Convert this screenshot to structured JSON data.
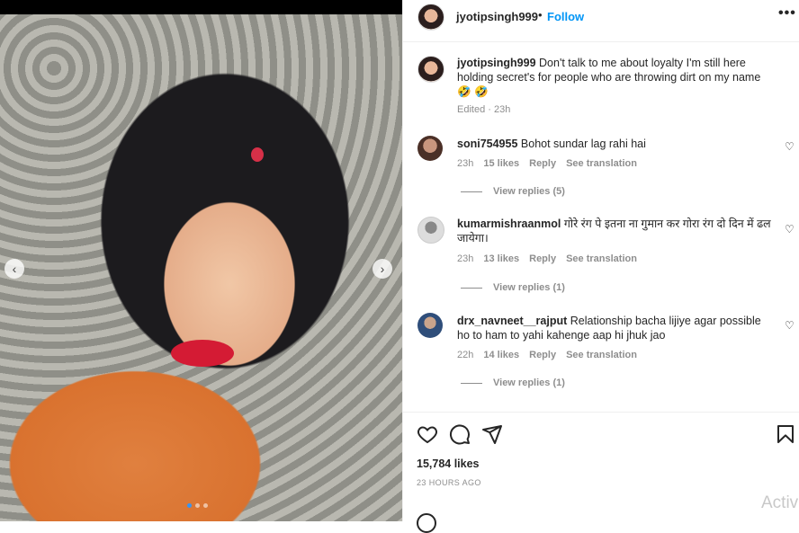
{
  "post": {
    "username": "jyotipsingh999",
    "separator": "•",
    "follow_label": "Follow",
    "more_label": "•••",
    "caption": {
      "username": "jyotipsingh999",
      "text": "Don't talk to me about loyalty I'm still here holding secret's for people who are throwing dirt on my name 🤣 🤣",
      "meta": "Edited · 23h"
    }
  },
  "media": {
    "prev_label": "‹",
    "next_label": "›",
    "slide_count": 3,
    "active_slide": 1
  },
  "comments": [
    {
      "username": "soni754955",
      "text": "Bohot sundar lag rahi hai",
      "time": "23h",
      "likes": "15 likes",
      "reply": "Reply",
      "translate": "See translation",
      "view_replies": "View replies (5)"
    },
    {
      "username": "kumarmishraanmol",
      "text": "गोरे रंग पे इतना ना गुमान कर गोरा रंग दो दिन में ढल जायेगा।",
      "time": "23h",
      "likes": "13 likes",
      "reply": "Reply",
      "translate": "See translation",
      "view_replies": "View replies (1)"
    },
    {
      "username": "drx_navneet__rajput",
      "text": "Relationship bacha lijiye agar possible ho to ham to yahi kahenge aap hi jhuk jao",
      "time": "22h",
      "likes": "14 likes",
      "reply": "Reply",
      "translate": "See translation",
      "view_replies": "View replies (1)"
    }
  ],
  "footer": {
    "likes": "15,784 likes",
    "posted": "23 HOURS AGO",
    "watermark": "Activ"
  },
  "colors": {
    "accent": "#0095f6",
    "muted": "#8e8e8e",
    "lips": "#d41b34"
  }
}
